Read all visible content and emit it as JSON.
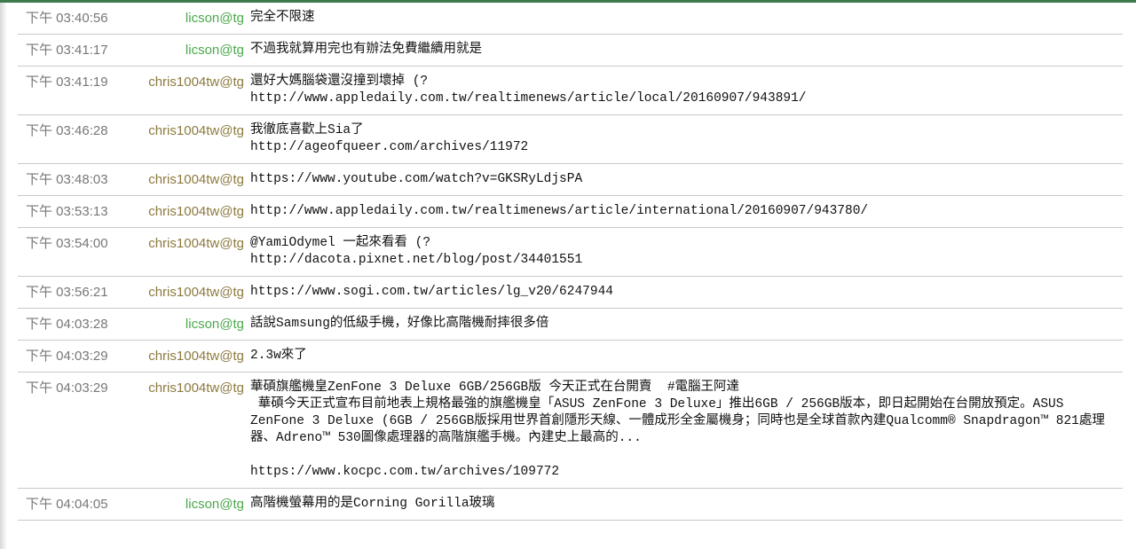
{
  "messages": [
    {
      "time": "下午 03:40:56",
      "nick": "licson@tg",
      "cls": "licson",
      "lines": [
        "完全不限速"
      ]
    },
    {
      "time": "下午 03:41:17",
      "nick": "licson@tg",
      "cls": "licson",
      "lines": [
        "不過我就算用完也有辦法免費繼續用就是"
      ]
    },
    {
      "time": "下午 03:41:19",
      "nick": "chris1004tw@tg",
      "cls": "chris",
      "lines": [
        "還好大媽腦袋還沒撞到壞掉 (?",
        "http://www.appledaily.com.tw/realtimenews/article/local/20160907/943891/"
      ]
    },
    {
      "time": "下午 03:46:28",
      "nick": "chris1004tw@tg",
      "cls": "chris",
      "lines": [
        "我徹底喜歡上Sia了",
        "http://ageofqueer.com/archives/11972"
      ]
    },
    {
      "time": "下午 03:48:03",
      "nick": "chris1004tw@tg",
      "cls": "chris",
      "lines": [
        "https://www.youtube.com/watch?v=GKSRyLdjsPA"
      ]
    },
    {
      "time": "下午 03:53:13",
      "nick": "chris1004tw@tg",
      "cls": "chris",
      "lines": [
        "http://www.appledaily.com.tw/realtimenews/article/international/20160907/943780/"
      ]
    },
    {
      "time": "下午 03:54:00",
      "nick": "chris1004tw@tg",
      "cls": "chris",
      "lines": [
        "@YamiOdymel 一起來看看 (?",
        "http://dacota.pixnet.net/blog/post/34401551"
      ]
    },
    {
      "time": "下午 03:56:21",
      "nick": "chris1004tw@tg",
      "cls": "chris",
      "lines": [
        "https://www.sogi.com.tw/articles/lg_v20/6247944"
      ]
    },
    {
      "time": "下午 04:03:28",
      "nick": "licson@tg",
      "cls": "licson",
      "lines": [
        "話說Samsung的低級手機，好像比高階機耐摔很多倍"
      ]
    },
    {
      "time": "下午 04:03:29",
      "nick": "chris1004tw@tg",
      "cls": "chris",
      "lines": [
        "2.3w來了"
      ]
    },
    {
      "time": "下午 04:03:29",
      "nick": "chris1004tw@tg",
      "cls": "chris",
      "lines": [
        "華碩旗艦機皇ZenFone 3 Deluxe 6GB/256GB版 今天正式在台開賣  #電腦王阿達",
        " 華碩今天正式宣布目前地表上規格最強的旗艦機皇「ASUS ZenFone 3 Deluxe」推出6GB / 256GB版本，即日起開始在台開放預定。ASUS ZenFone 3 Deluxe (6GB / 256GB版採用世界首創隱形天線、一體成形全金屬機身；同時也是全球首款內建Qualcomm® Snapdragon™ 821處理器、Adreno™ 530圖像處理器的高階旗艦手機。內建史上最高的...",
        "",
        "https://www.kocpc.com.tw/archives/109772"
      ]
    },
    {
      "time": "下午 04:04:05",
      "nick": "licson@tg",
      "cls": "licson",
      "lines": [
        "高階機螢幕用的是Corning Gorilla玻璃"
      ]
    }
  ]
}
